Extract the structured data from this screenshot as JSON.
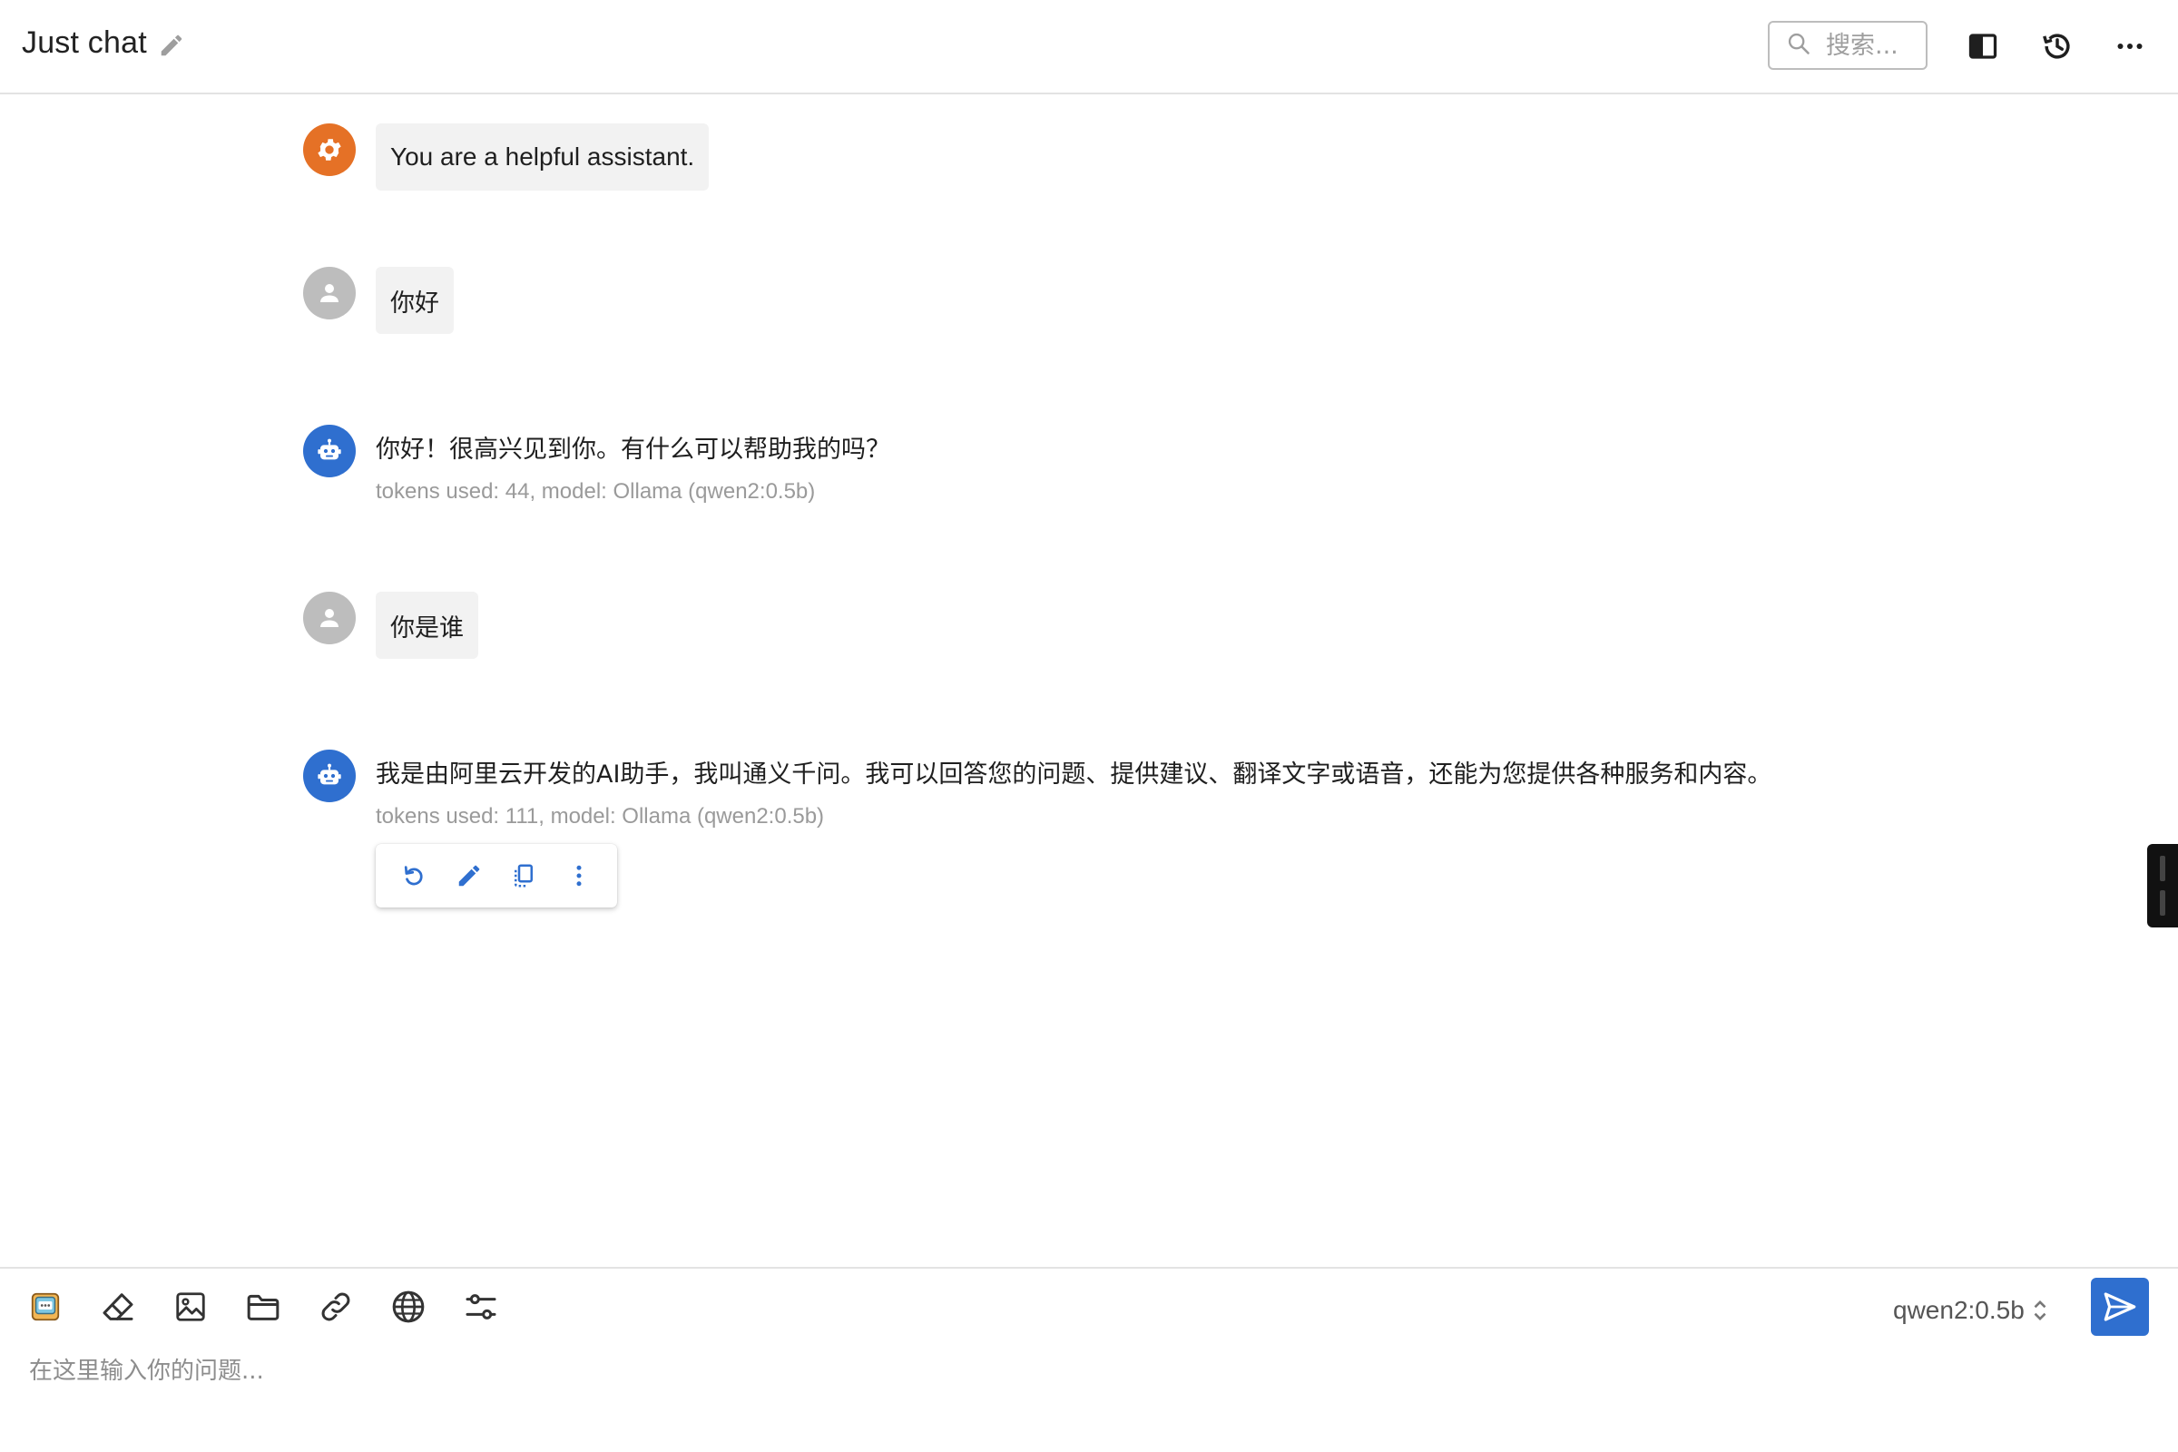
{
  "header": {
    "title": "Just chat",
    "search_placeholder": "搜索..."
  },
  "messages": [
    {
      "role": "system",
      "text": "You are a helpful assistant."
    },
    {
      "role": "user",
      "text": "你好"
    },
    {
      "role": "assistant",
      "text": "你好！很高兴见到你。有什么可以帮助我的吗？",
      "meta": "tokens used: 44, model: Ollama (qwen2:0.5b)"
    },
    {
      "role": "user",
      "text": "你是谁"
    },
    {
      "role": "assistant",
      "text": "我是由阿里云开发的AI助手，我叫通义千问。我可以回答您的问题、提供建议、翻译文字或语音，还能为您提供各种服务和内容。",
      "meta": "tokens used: 111, model: Ollama (qwen2:0.5b)"
    }
  ],
  "composer": {
    "model": "qwen2:0.5b",
    "placeholder": "在这里输入你的问题..."
  },
  "colors": {
    "accent": "#2f6fcf",
    "system_avatar": "#e57126",
    "user_avatar": "#bdbdbd"
  }
}
